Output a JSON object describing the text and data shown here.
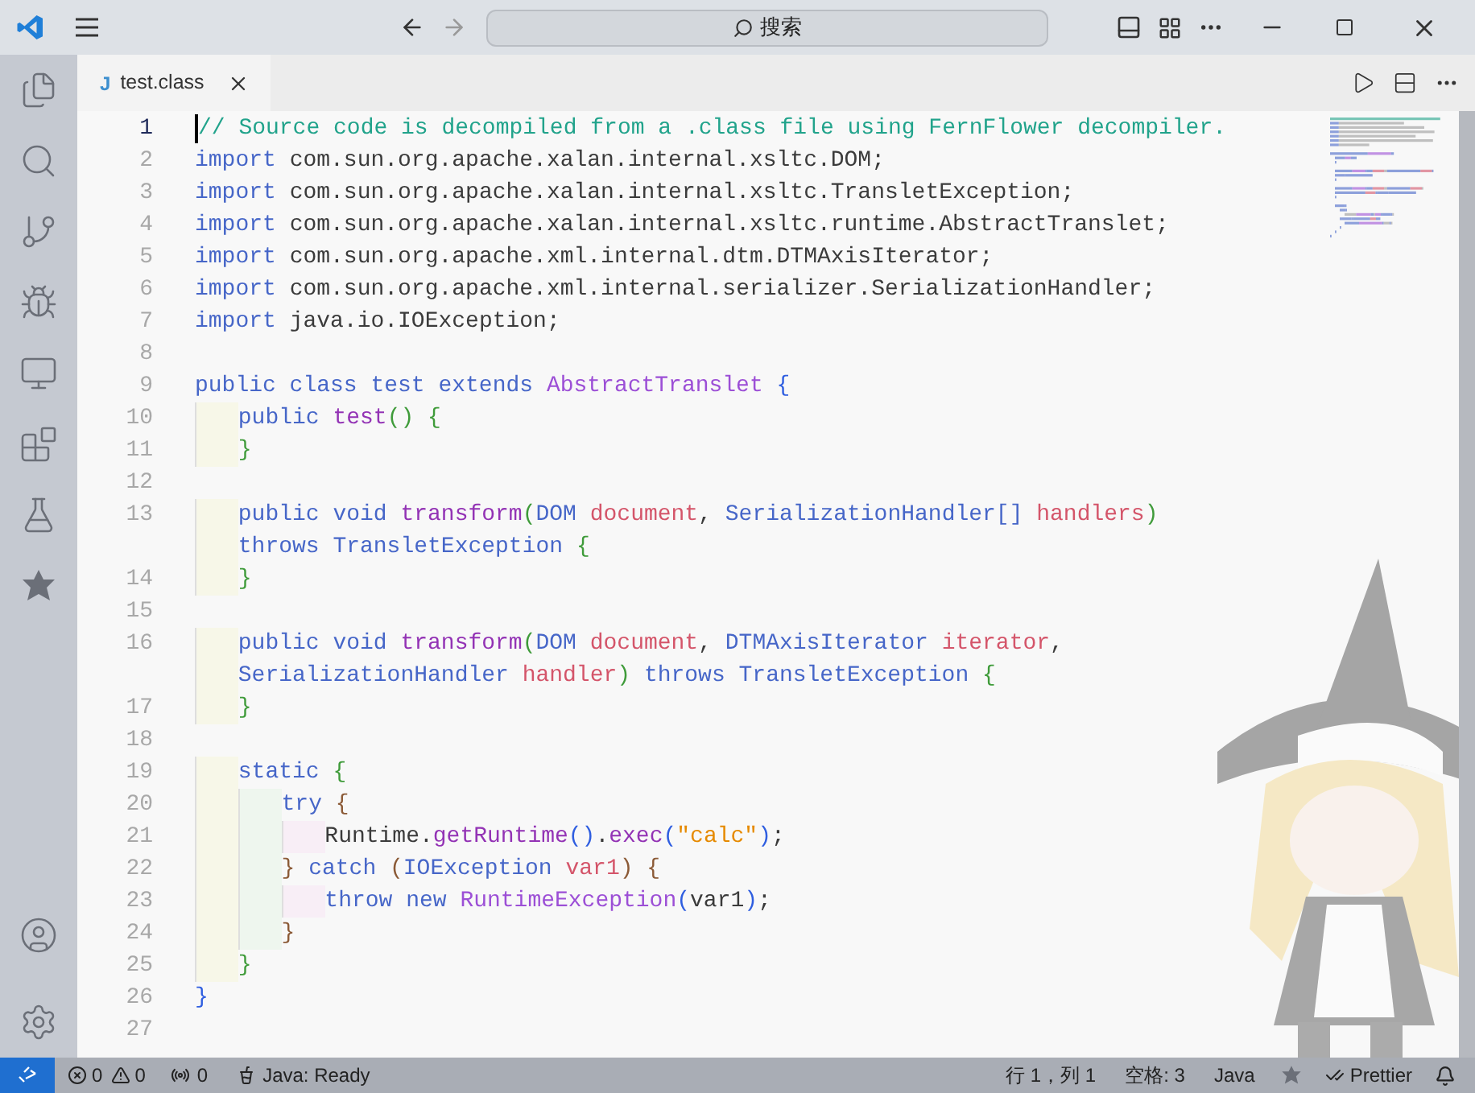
{
  "title_bar": {
    "search": {
      "placeholder": "搜索"
    }
  },
  "tabs": [
    {
      "label": "test.class",
      "icon_text": "J",
      "selected": true
    }
  ],
  "editor": {
    "lines": [
      {
        "number": "1",
        "current": true,
        "tokens": [
          {
            "kind": "comment",
            "text": "// Source code is decompiled from a .class file using FernFlower decompiler."
          }
        ]
      },
      {
        "number": "2",
        "current": false,
        "tokens": [
          {
            "kind": "keyword",
            "text": "import"
          },
          {
            "kind": "plain",
            "text": " com.sun.org.apache.xalan.internal.xsltc.DOM;"
          }
        ]
      },
      {
        "number": "3",
        "current": false,
        "tokens": [
          {
            "kind": "keyword",
            "text": "import"
          },
          {
            "kind": "plain",
            "text": " com.sun.org.apache.xalan.internal.xsltc.TransletException;"
          }
        ]
      },
      {
        "number": "4",
        "current": false,
        "tokens": [
          {
            "kind": "keyword",
            "text": "import"
          },
          {
            "kind": "plain",
            "text": " com.sun.org.apache.xalan.internal.xsltc.runtime.AbstractTranslet;"
          }
        ]
      },
      {
        "number": "5",
        "current": false,
        "tokens": [
          {
            "kind": "keyword",
            "text": "import"
          },
          {
            "kind": "plain",
            "text": " com.sun.org.apache.xml.internal.dtm.DTMAxisIterator;"
          }
        ]
      },
      {
        "number": "6",
        "current": false,
        "tokens": [
          {
            "kind": "keyword",
            "text": "import"
          },
          {
            "kind": "plain",
            "text": " com.sun.org.apache.xml.internal.serializer.SerializationHandler;"
          }
        ]
      },
      {
        "number": "7",
        "current": false,
        "tokens": [
          {
            "kind": "keyword",
            "text": "import"
          },
          {
            "kind": "plain",
            "text": " java.io.IOException;"
          }
        ]
      },
      {
        "number": "8",
        "current": false
      },
      {
        "number": "9",
        "current": false,
        "tokens": [
          {
            "kind": "keyword",
            "text": "public class test extends "
          },
          {
            "kind": "class",
            "text": "AbstractTranslet"
          },
          {
            "kind": "brace1",
            "text": " {"
          }
        ],
        "children": [
          {
            "number": "10",
            "current": false,
            "tokens": [
              {
                "kind": "keyword",
                "text": "public "
              },
              {
                "kind": "method",
                "text": "test"
              },
              {
                "kind": "brace2",
                "text": "() {"
              }
            ]
          },
          {
            "number": "11",
            "current": false,
            "tokens": [
              {
                "kind": "brace2",
                "text": "}"
              }
            ]
          },
          {
            "number": "12",
            "current": false
          },
          {
            "number": "13",
            "current": false,
            "tokens": [
              {
                "kind": "keyword",
                "text": "public void "
              },
              {
                "kind": "method",
                "text": "transform"
              },
              {
                "kind": "brace2",
                "text": "("
              },
              {
                "kind": "type",
                "text": "DOM "
              },
              {
                "kind": "param",
                "text": "document"
              },
              {
                "kind": "plain",
                "text": ", "
              },
              {
                "kind": "type",
                "text": "SerializationHandler[] "
              },
              {
                "kind": "param",
                "text": "handlers"
              },
              {
                "kind": "brace2",
                "text": ")"
              }
            ]
          },
          {
            "current": false,
            "tokens": [
              {
                "kind": "keyword",
                "text": "throws "
              },
              {
                "kind": "type",
                "text": "TransletException "
              },
              {
                "kind": "brace2",
                "text": "{"
              }
            ]
          },
          {
            "number": "14",
            "current": false,
            "tokens": [
              {
                "kind": "brace2",
                "text": "}"
              }
            ]
          },
          {
            "number": "15",
            "current": false
          },
          {
            "number": "16",
            "current": false,
            "tokens": [
              {
                "kind": "keyword",
                "text": "public void "
              },
              {
                "kind": "method",
                "text": "transform"
              },
              {
                "kind": "brace2",
                "text": "("
              },
              {
                "kind": "type",
                "text": "DOM "
              },
              {
                "kind": "param",
                "text": "document"
              },
              {
                "kind": "plain",
                "text": ", "
              },
              {
                "kind": "type",
                "text": "DTMAxisIterator "
              },
              {
                "kind": "param",
                "text": "iterator"
              },
              {
                "kind": "plain",
                "text": ","
              }
            ]
          },
          {
            "current": false,
            "tokens": [
              {
                "kind": "type",
                "text": "SerializationHandler "
              },
              {
                "kind": "param",
                "text": "handler"
              },
              {
                "kind": "brace2",
                "text": ")"
              },
              {
                "kind": "keyword",
                "text": " throws "
              },
              {
                "kind": "type",
                "text": "TransletException "
              },
              {
                "kind": "brace2",
                "text": "{"
              }
            ]
          },
          {
            "number": "17",
            "current": false,
            "tokens": [
              {
                "kind": "brace2",
                "text": "}"
              }
            ]
          },
          {
            "number": "18",
            "current": false
          },
          {
            "number": "19",
            "current": false,
            "tokens": [
              {
                "kind": "keyword",
                "text": "static "
              },
              {
                "kind": "brace2",
                "text": "{"
              }
            ],
            "children": [
              {
                "number": "20",
                "current": false,
                "tokens": [
                  {
                    "kind": "keyword",
                    "text": "try "
                  },
                  {
                    "kind": "brace3",
                    "text": "{"
                  }
                ],
                "children": [
                  {
                    "number": "21",
                    "current": false,
                    "tokens": [
                      {
                        "kind": "plain",
                        "text": "Runtime."
                      },
                      {
                        "kind": "method",
                        "text": "getRuntime"
                      },
                      {
                        "kind": "brace1",
                        "text": "()"
                      },
                      {
                        "kind": "plain",
                        "text": "."
                      },
                      {
                        "kind": "method",
                        "text": "exec"
                      },
                      {
                        "kind": "brace1",
                        "text": "("
                      },
                      {
                        "kind": "string",
                        "text": "\"calc\""
                      },
                      {
                        "kind": "brace1",
                        "text": ")"
                      },
                      {
                        "kind": "plain",
                        "text": ";"
                      }
                    ]
                  }
                ]
              },
              {
                "number": "22",
                "current": false,
                "tokens": [
                  {
                    "kind": "brace3",
                    "text": "}"
                  },
                  {
                    "kind": "keyword",
                    "text": " catch "
                  },
                  {
                    "kind": "brace3",
                    "text": "("
                  },
                  {
                    "kind": "type",
                    "text": "IOException "
                  },
                  {
                    "kind": "param",
                    "text": "var1"
                  },
                  {
                    "kind": "brace3",
                    "text": ") {"
                  }
                ],
                "children": [
                  {
                    "number": "23",
                    "current": false,
                    "tokens": [
                      {
                        "kind": "keyword",
                        "text": "throw new "
                      },
                      {
                        "kind": "class",
                        "text": "RuntimeException"
                      },
                      {
                        "kind": "brace1",
                        "text": "("
                      },
                      {
                        "kind": "plain",
                        "text": "var1"
                      },
                      {
                        "kind": "brace1",
                        "text": ")"
                      },
                      {
                        "kind": "plain",
                        "text": ";"
                      }
                    ]
                  }
                ]
              },
              {
                "number": "24",
                "current": false,
                "tokens": [
                  {
                    "kind": "brace3",
                    "text": "}"
                  }
                ]
              }
            ]
          },
          {
            "number": "25",
            "current": false,
            "tokens": [
              {
                "kind": "brace2",
                "text": "}"
              }
            ]
          }
        ]
      },
      {
        "number": "26",
        "current": false,
        "tokens": [
          {
            "kind": "brace1",
            "text": "}"
          }
        ]
      },
      {
        "number": "27",
        "current": false
      }
    ]
  },
  "status_bar": {
    "errors": "0",
    "warnings": "0",
    "ports": "0",
    "java_status": "Java: Ready",
    "position": "行 1，列 1",
    "spaces": "空格: 3",
    "language": "Java",
    "formatter": "Prettier"
  }
}
